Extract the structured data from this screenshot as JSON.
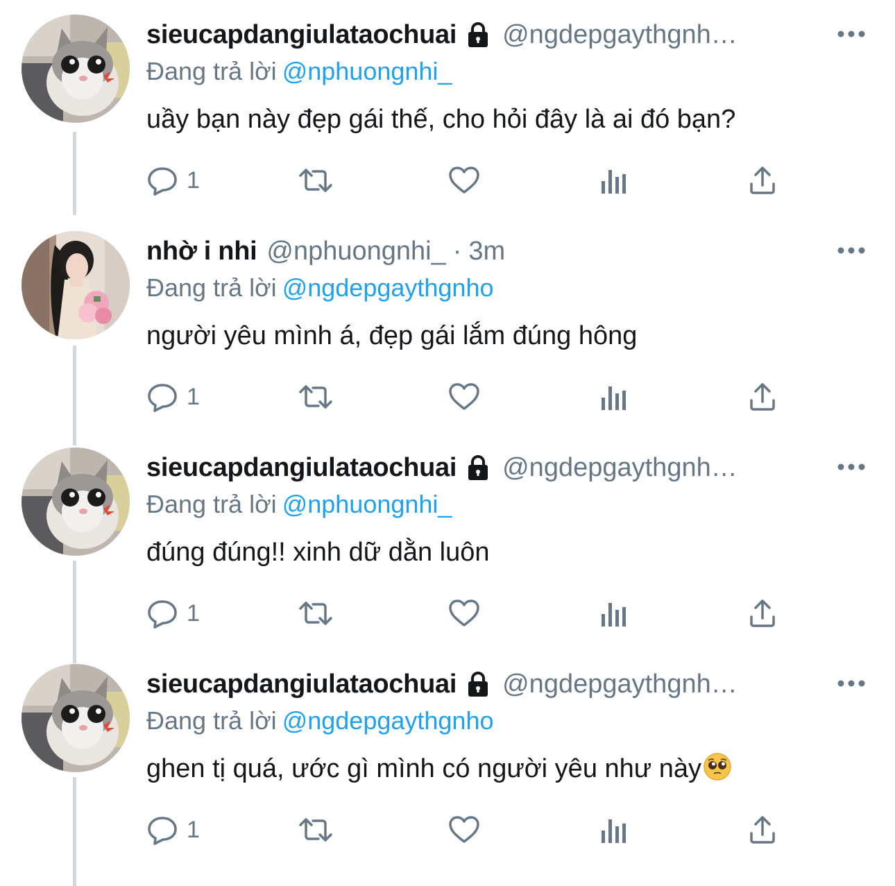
{
  "colors": {
    "text": "#14171a",
    "secondary": "#657786",
    "link": "#1da1f2",
    "thread_line": "#cfd9de"
  },
  "tweets": [
    {
      "avatar": "cat-avatar",
      "display_name": "sieucapdangiulataochuai",
      "protected": true,
      "handle": "@ngdepgaythgnh…",
      "replying_label": "Đang trả lời",
      "replying_to": "@nphuongnhi_",
      "text": "uầy bạn này đẹp gái thế, cho hỏi đây là ai đó bạn?",
      "reply_count": "1"
    },
    {
      "avatar": "girl-avatar",
      "display_name": "nhờ i nhi",
      "protected": false,
      "handle": "@nphuongnhi_",
      "time_separator": "·",
      "time": "3m",
      "replying_label": "Đang trả lời",
      "replying_to": "@ngdepgaythgnho",
      "text": "người yêu mình á, đẹp gái lắm đúng hông",
      "reply_count": "1"
    },
    {
      "avatar": "cat-avatar",
      "display_name": "sieucapdangiulataochuai",
      "protected": true,
      "handle": "@ngdepgaythgnh…",
      "replying_label": "Đang trả lời",
      "replying_to": "@nphuongnhi_",
      "text": "đúng đúng!! xinh dữ dằn luôn",
      "reply_count": "1"
    },
    {
      "avatar": "cat-avatar",
      "display_name": "sieucapdangiulataochuai",
      "protected": true,
      "handle": "@ngdepgaythgnh…",
      "replying_label": "Đang trả lời",
      "replying_to": "@ngdepgaythgnho",
      "text": "ghen tị quá, ước gì mình có người yêu như này",
      "emoji": "pleading-face-emoji",
      "reply_count": "1"
    }
  ],
  "icons": {
    "more": "more-horizontal-icon",
    "reply": "reply-bubble-icon",
    "retweet": "retweet-icon",
    "like": "heart-icon",
    "views": "analytics-icon",
    "share": "share-icon",
    "lock": "lock-icon"
  }
}
